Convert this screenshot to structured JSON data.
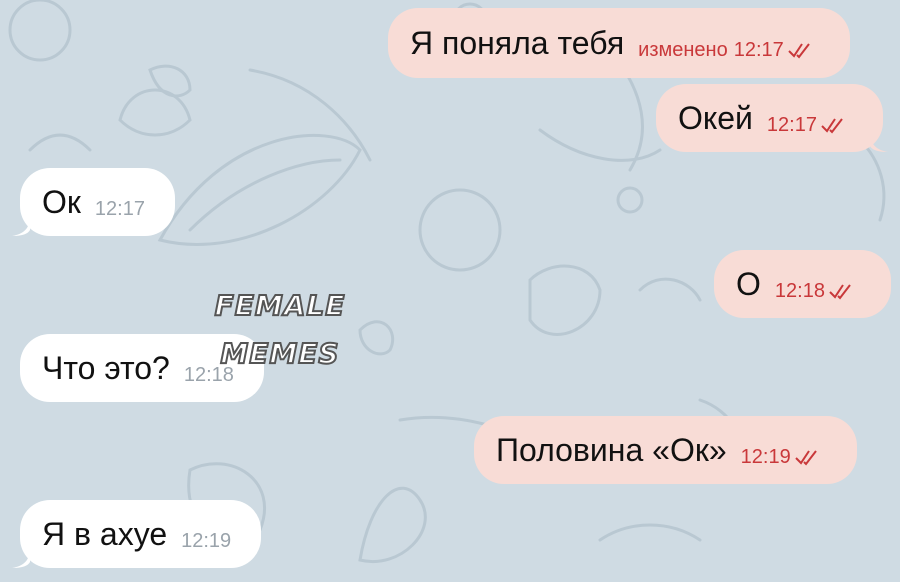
{
  "chat": {
    "messages": [
      {
        "side": "outgoing",
        "text": "Я поняла тебя",
        "edited_label": "изменено",
        "time": "12:17",
        "status": "read"
      },
      {
        "side": "outgoing",
        "text": "Окей",
        "time": "12:17",
        "status": "read"
      },
      {
        "side": "incoming",
        "text": "Ок",
        "time": "12:17"
      },
      {
        "side": "outgoing",
        "text": "О",
        "time": "12:18",
        "status": "read"
      },
      {
        "side": "incoming",
        "text": "Что это?",
        "time": "12:18"
      },
      {
        "side": "outgoing",
        "text": "Половина «Ок»",
        "time": "12:19",
        "status": "read"
      },
      {
        "side": "incoming",
        "text": "Я в ахуе",
        "time": "12:19"
      }
    ]
  },
  "watermark": {
    "line1": "FEMALE",
    "line2": "MEMES"
  },
  "colors": {
    "background": "#cfdbe3",
    "outgoing_bubble": "#f8dcd6",
    "incoming_bubble": "#ffffff",
    "outgoing_meta": "#c9383a",
    "incoming_meta": "#9aa3ab"
  }
}
